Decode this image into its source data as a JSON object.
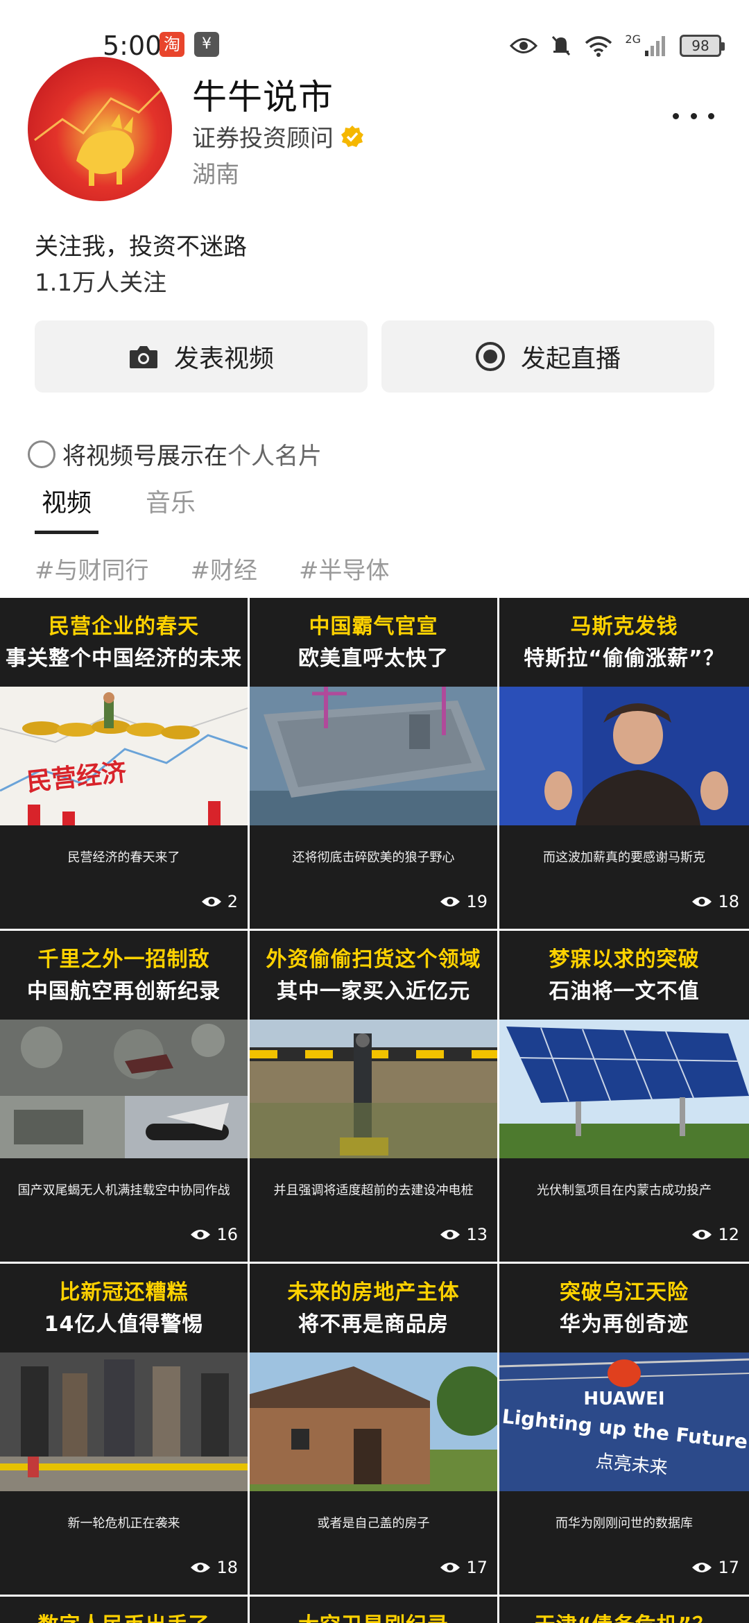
{
  "status_bar": {
    "time": "5:00",
    "app_icon_1": "淘",
    "app_icon_2": "¥",
    "network": "2G",
    "battery": "98"
  },
  "profile": {
    "name": "牛牛说市",
    "certification": "证券投资顾问",
    "region": "湖南",
    "bio": "关注我，投资不迷路",
    "followers": "1.1万人关注",
    "accent_color": "#f5b700"
  },
  "actions": {
    "post_video": "发表视频",
    "start_live": "发起直播"
  },
  "show_on_card": {
    "prefix": "将视频号展示在",
    "link": "个人名片"
  },
  "tabs": [
    {
      "label": "视频",
      "active": true
    },
    {
      "label": "音乐",
      "active": false
    }
  ],
  "hashtags": [
    "#与财同行",
    "#财经",
    "#半导体"
  ],
  "videos": [
    {
      "title1": "民营企业的春天",
      "title2": "事关整个中国经济的未来",
      "caption": "民营经济的春天来了",
      "views": "2",
      "thumb": "coins"
    },
    {
      "title1": "中国霸气官宣",
      "title2": "欧美直呼太快了",
      "caption": "还将彻底击碎欧美的狼子野心",
      "views": "19",
      "thumb": "carrier"
    },
    {
      "title1": "马斯克发钱",
      "title2": "特斯拉“偷偷涨薪”？",
      "caption": "而这波加薪真的要感谢马斯克",
      "views": "18",
      "thumb": "person"
    },
    {
      "title1": "千里之外一招制敌",
      "title2": "中国航空再创新纪录",
      "caption": "国产双尾蝎无人机满挂载空中协同作战",
      "views": "16",
      "thumb": "drone"
    },
    {
      "title1": "外资偷偷扫货这个领域",
      "title2": "其中一家买入近亿元",
      "caption": "并且强调将适度超前的去建设冲电桩",
      "views": "13",
      "thumb": "charger"
    },
    {
      "title1": "梦寐以求的突破",
      "title2": "石油将一文不值",
      "caption": "光伏制氢项目在内蒙古成功投产",
      "views": "12",
      "thumb": "solar"
    },
    {
      "title1": "比新冠还糟糕",
      "title2": "14亿人值得警惕",
      "caption": "新一轮危机正在袭来",
      "views": "18",
      "thumb": "street"
    },
    {
      "title1": "未来的房地产主体",
      "title2": "将不再是商品房",
      "caption": "或者是自己盖的房子",
      "views": "17",
      "thumb": "house"
    },
    {
      "title1": "突破乌江天险",
      "title2": "华为再创奇迹",
      "caption": "而华为刚刚问世的数据库",
      "views": "17",
      "thumb": "huawei",
      "thumb_text1": "HUAWEI",
      "thumb_text2": "Lighting up the Future",
      "thumb_text3": "点亮未来"
    }
  ],
  "partial_videos": [
    {
      "title1": "数字人民币出手了"
    },
    {
      "title1": "大空卫星刷纪录"
    },
    {
      "title1": "天津“债务危机”？"
    }
  ]
}
